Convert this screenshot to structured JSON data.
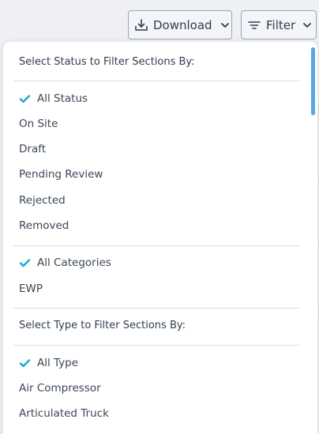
{
  "toolbar": {
    "download_label": "Download",
    "filter_label": "Filter"
  },
  "colors": {
    "accent": "#19a7d7",
    "text": "#2f3d4c",
    "border": "#9ba7b4"
  },
  "icons": {
    "download": "download-tray-icon",
    "filter": "filter-lines-icon",
    "chevron": "chevron-down-icon",
    "check": "checkmark-icon"
  },
  "filter_menu": {
    "status_heading": "Select Status to Filter Sections By:",
    "status_options": [
      {
        "label": "All Status",
        "selected": true
      },
      {
        "label": "On Site",
        "selected": false
      },
      {
        "label": "Draft",
        "selected": false
      },
      {
        "label": "Pending Review",
        "selected": false
      },
      {
        "label": "Rejected",
        "selected": false
      },
      {
        "label": "Removed",
        "selected": false
      }
    ],
    "category_options": [
      {
        "label": "All Categories",
        "selected": true
      },
      {
        "label": "EWP",
        "selected": false
      }
    ],
    "type_heading": "Select Type to Filter Sections By:",
    "type_options": [
      {
        "label": "All Type",
        "selected": true
      },
      {
        "label": "Air Compressor",
        "selected": false
      },
      {
        "label": "Articulated Truck",
        "selected": false
      }
    ]
  }
}
